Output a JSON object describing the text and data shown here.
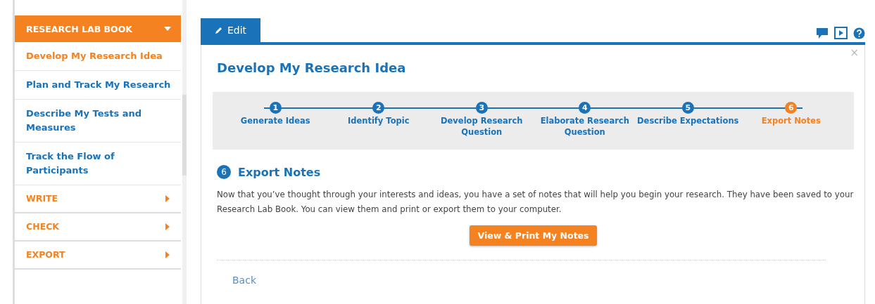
{
  "sidebar": {
    "header": {
      "label": "RESEARCH LAB BOOK",
      "expanded": true
    },
    "items": [
      {
        "kind": "link",
        "label": "Develop My Research Idea",
        "selected": true
      },
      {
        "kind": "link",
        "label": "Plan and Track My Research",
        "selected": false
      },
      {
        "kind": "link",
        "label": "Describe My Tests and Measures",
        "selected": false
      },
      {
        "kind": "link",
        "label": "Track the Flow of Participants",
        "selected": false
      },
      {
        "kind": "section",
        "label": "WRITE"
      },
      {
        "kind": "section",
        "label": "CHECK"
      },
      {
        "kind": "section",
        "label": "EXPORT"
      }
    ]
  },
  "tabs": [
    {
      "label": "Edit",
      "selected": true
    }
  ],
  "panel": {
    "close": "×",
    "title": "Develop My Research Idea",
    "steps": [
      {
        "number": "1",
        "label": "Generate Ideas",
        "selected": false
      },
      {
        "number": "2",
        "label": "Identify Topic",
        "selected": false
      },
      {
        "number": "3",
        "label": "Develop Research Question",
        "selected": false
      },
      {
        "number": "4",
        "label": "Elaborate Research Question",
        "selected": false
      },
      {
        "number": "5",
        "label": "Describe Expectations",
        "selected": false
      },
      {
        "number": "6",
        "label": "Export Notes",
        "selected": true
      }
    ],
    "section": {
      "number": "6",
      "title": "Export Notes",
      "body": "Now that you’ve thought through your interests and ideas, you have a set of notes that will help you begin your research. They have been saved to your Research Lab Book. You can view them and print or export them to your computer.",
      "button": "View & Print My Notes"
    },
    "back": "Back"
  }
}
